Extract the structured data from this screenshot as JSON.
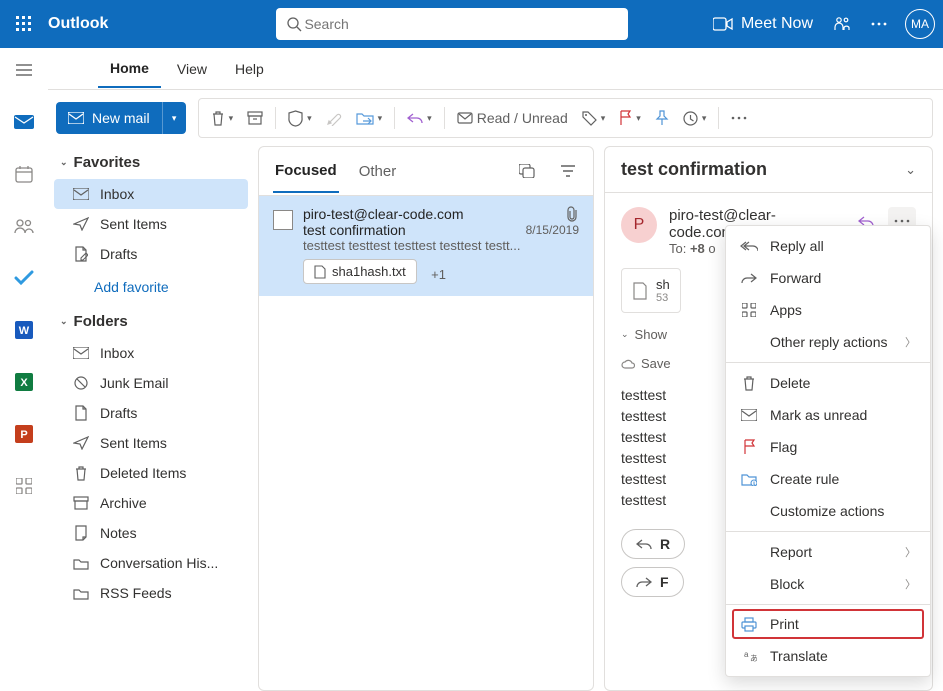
{
  "topbar": {
    "app_name": "Outlook",
    "search_placeholder": "Search",
    "meet_now": "Meet Now",
    "avatar_initials": "MA"
  },
  "tabs": {
    "home": "Home",
    "view": "View",
    "help": "Help"
  },
  "commands": {
    "new_mail": "New mail",
    "read_unread": "Read / Unread"
  },
  "sidebar": {
    "favorites_label": "Favorites",
    "favorites": [
      {
        "label": "Inbox"
      },
      {
        "label": "Sent Items"
      },
      {
        "label": "Drafts"
      }
    ],
    "add_favorite": "Add favorite",
    "folders_label": "Folders",
    "folders": [
      {
        "label": "Inbox"
      },
      {
        "label": "Junk Email"
      },
      {
        "label": "Drafts"
      },
      {
        "label": "Sent Items"
      },
      {
        "label": "Deleted Items"
      },
      {
        "label": "Archive"
      },
      {
        "label": "Notes"
      },
      {
        "label": "Conversation His..."
      },
      {
        "label": "RSS Feeds"
      }
    ]
  },
  "msglist": {
    "focused": "Focused",
    "other": "Other",
    "item": {
      "from": "piro-test@clear-code.com",
      "subject": "test confirmation",
      "date": "8/15/2019",
      "preview": "testtest testtest testtest testtest testt...",
      "attachment": "sha1hash.txt",
      "more_attach": "+1"
    }
  },
  "reading": {
    "subject": "test confirmation",
    "sender_initial": "P",
    "sender_addr": "piro-test@clear-code.com",
    "to_line_prefix": "To:",
    "to_line_count": "+8",
    "attach_name_trunc": "sh",
    "attach_size_trunc": "53",
    "show_1_more": "Show",
    "save_all": "Save",
    "body_line": "testtest",
    "reply_label": "R",
    "forward_label": "F"
  },
  "context_menu": {
    "items": [
      {
        "key": "reply_all",
        "label": "Reply all",
        "icon": "reply-all"
      },
      {
        "key": "forward",
        "label": "Forward",
        "icon": "forward"
      },
      {
        "key": "apps",
        "label": "Apps",
        "icon": "apps"
      },
      {
        "key": "other",
        "label": "Other reply actions",
        "icon": "",
        "arrow": true
      },
      {
        "key": "sep1",
        "sep": true
      },
      {
        "key": "delete",
        "label": "Delete",
        "icon": "delete"
      },
      {
        "key": "mark_unread",
        "label": "Mark as unread",
        "icon": "mail"
      },
      {
        "key": "flag",
        "label": "Flag",
        "icon": "flag"
      },
      {
        "key": "create_rule",
        "label": "Create rule",
        "icon": "rule"
      },
      {
        "key": "customize",
        "label": "Customize actions",
        "icon": ""
      },
      {
        "key": "sep2",
        "sep": true
      },
      {
        "key": "report",
        "label": "Report",
        "icon": "",
        "arrow": true
      },
      {
        "key": "block",
        "label": "Block",
        "icon": "",
        "arrow": true
      },
      {
        "key": "sep3",
        "sep": true
      },
      {
        "key": "print",
        "label": "Print",
        "icon": "print",
        "highlight": true
      },
      {
        "key": "translate",
        "label": "Translate",
        "icon": "translate"
      }
    ]
  }
}
